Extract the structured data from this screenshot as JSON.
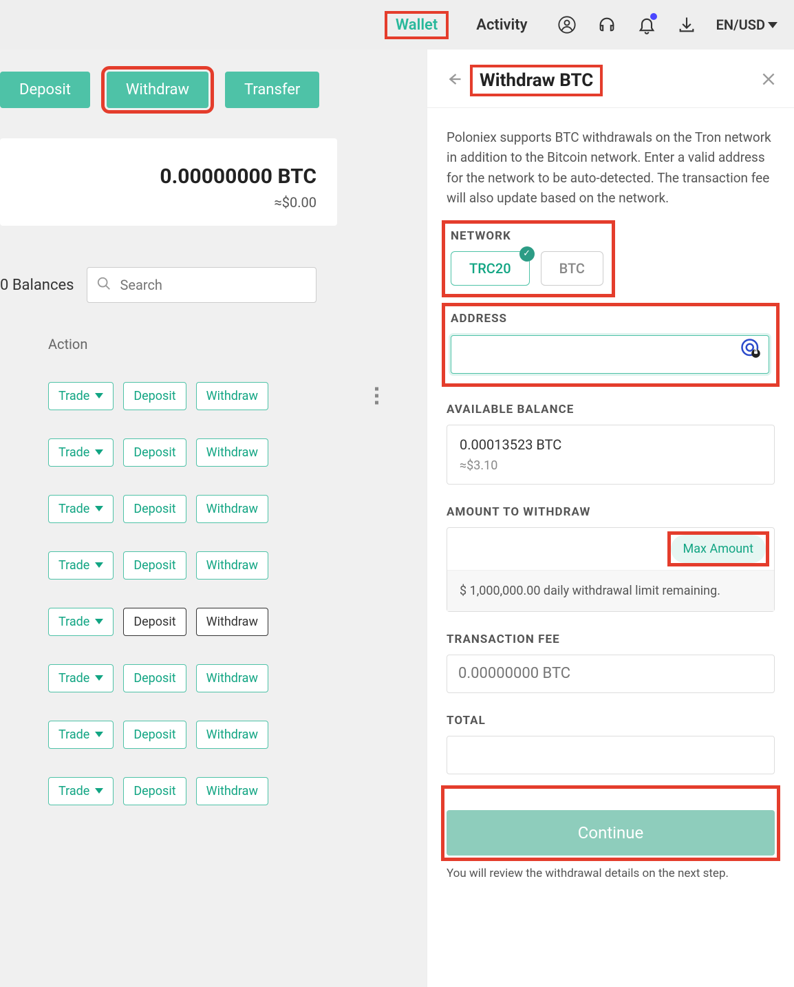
{
  "header": {
    "tabs": {
      "wallet": "Wallet",
      "activity": "Activity"
    },
    "lang": "EN/USD"
  },
  "actions": {
    "deposit": "Deposit",
    "withdraw": "Withdraw",
    "transfer": "Transfer"
  },
  "balance": {
    "main": "0.00000000 BTC",
    "sub": "≈$0.00"
  },
  "balances_label": "0 Balances",
  "search_placeholder": "Search",
  "action_header": "Action",
  "rows": [
    {
      "trade": "Trade",
      "deposit": "Deposit",
      "withdraw": "Withdraw",
      "dep_gray": false,
      "wd_gray": false,
      "kebab": true
    },
    {
      "trade": "Trade",
      "deposit": "Deposit",
      "withdraw": "Withdraw",
      "dep_gray": false,
      "wd_gray": false,
      "kebab": false
    },
    {
      "trade": "Trade",
      "deposit": "Deposit",
      "withdraw": "Withdraw",
      "dep_gray": false,
      "wd_gray": false,
      "kebab": false
    },
    {
      "trade": "Trade",
      "deposit": "Deposit",
      "withdraw": "Withdraw",
      "dep_gray": false,
      "wd_gray": false,
      "kebab": false
    },
    {
      "trade": "Trade",
      "deposit": "Deposit",
      "withdraw": "Withdraw",
      "dep_gray": true,
      "wd_gray": true,
      "kebab": false
    },
    {
      "trade": "Trade",
      "deposit": "Deposit",
      "withdraw": "Withdraw",
      "dep_gray": false,
      "wd_gray": false,
      "kebab": false
    },
    {
      "trade": "Trade",
      "deposit": "Deposit",
      "withdraw": "Withdraw",
      "dep_gray": false,
      "wd_gray": false,
      "kebab": false
    },
    {
      "trade": "Trade",
      "deposit": "Deposit",
      "withdraw": "Withdraw",
      "dep_gray": false,
      "wd_gray": false,
      "kebab": false
    }
  ],
  "panel": {
    "title": "Withdraw BTC",
    "info": "Poloniex supports BTC withdrawals on the Tron network in addition to the Bitcoin network. Enter a valid address for the network to be auto-detected. The transaction fee will also update based on the network.",
    "labels": {
      "network": "NETWORK",
      "address": "ADDRESS",
      "available": "AVAILABLE BALANCE",
      "amount": "AMOUNT TO WITHDRAW",
      "fee": "TRANSACTION FEE",
      "total": "TOTAL"
    },
    "networks": {
      "trc20": "TRC20",
      "btc": "BTC"
    },
    "available": {
      "l1": "0.00013523 BTC",
      "l2": "≈$3.10"
    },
    "max_label": "Max Amount",
    "limit_text": "$ 1,000,000.00 daily withdrawal limit remaining.",
    "fee_placeholder": "0.00000000 BTC",
    "continue": "Continue",
    "next_note": "You will review the withdrawal details on the next step."
  }
}
